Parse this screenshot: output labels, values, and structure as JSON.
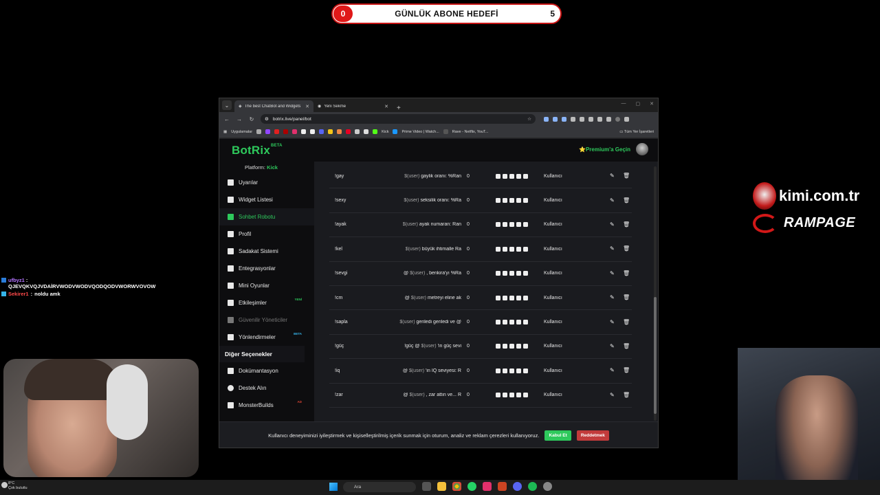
{
  "goal": {
    "current": "0",
    "title": "GÜNLÜK ABONE HEDEFİ",
    "target": "5"
  },
  "browser": {
    "tabs": [
      {
        "title": "The best ChatBot and Widgets",
        "active": true
      },
      {
        "title": "Yeni Sekme",
        "active": false
      }
    ],
    "url": "botrix.live/panel/bot",
    "bookmarks": [
      "Uygulamalar",
      "Kick",
      "Prime Video | Watch...",
      "Rave - Netflix, YouT..."
    ],
    "bookmarks_right": "Tüm Yer İşaretleri"
  },
  "botrix": {
    "logo": "BotRix",
    "beta": "BETA",
    "premium": "⭐Premium'a Geçin",
    "platform_label": "Platform:",
    "platform_value": "Kick",
    "nav": [
      {
        "label": "Uyarılar",
        "icon": "warning-icon",
        "state": "normal",
        "badge": ""
      },
      {
        "label": "Widget Listesi",
        "icon": "widgets-icon",
        "state": "normal",
        "badge": ""
      },
      {
        "label": "Sohbet Robotu",
        "icon": "robot-icon",
        "state": "active",
        "badge": ""
      },
      {
        "label": "Profil",
        "icon": "profile-icon",
        "state": "normal",
        "badge": ""
      },
      {
        "label": "Sadakat Sistemi",
        "icon": "trophy-icon",
        "state": "normal",
        "badge": ""
      },
      {
        "label": "Entegrasyonlar",
        "icon": "integrations-icon",
        "state": "normal",
        "badge": ""
      },
      {
        "label": "Mini Oyunlar",
        "icon": "gamepad-icon",
        "state": "normal",
        "badge": ""
      },
      {
        "label": "Etkileşimler",
        "icon": "music-icon",
        "state": "normal",
        "badge": "YENİ"
      },
      {
        "label": "Güvenilir Yöneticiler",
        "icon": "shield-icon",
        "state": "disabled",
        "badge": ""
      },
      {
        "label": "Yönlendirmeler",
        "icon": "users-icon",
        "state": "normal",
        "badge": "BETA"
      }
    ],
    "other_section": "Diğer Seçenekler",
    "other_nav": [
      {
        "label": "Dokümantasyon",
        "icon": "docs-icon",
        "badge": ""
      },
      {
        "label": "Destek Alın",
        "icon": "help-icon",
        "badge": ""
      },
      {
        "label": "MonsterBuilds",
        "icon": "monitor-icon",
        "badge": "AD"
      }
    ],
    "commands": [
      {
        "name": "!gay",
        "response_pre": "",
        "response_user": "$(user)",
        "response_post": " gaylik oranı: %Ran",
        "count": "0",
        "permission": "Kullanıcı"
      },
      {
        "name": "!sexy",
        "response_pre": "",
        "response_user": "$(user)",
        "response_post": " seksilik oranı: %Ra",
        "count": "0",
        "permission": "Kullanıcı"
      },
      {
        "name": "!ayak",
        "response_pre": "",
        "response_user": "$(user)",
        "response_post": " ayak numaran: Ran",
        "count": "0",
        "permission": "Kullanıcı"
      },
      {
        "name": "!kel",
        "response_pre": "",
        "response_user": "$(user)",
        "response_post": " büyük ihtimalle Ra",
        "count": "0",
        "permission": "Kullanıcı"
      },
      {
        "name": "!sevgi",
        "response_pre": "@ ",
        "response_user": "$(user)",
        "response_post": " , benkira'yı %Ra",
        "count": "0",
        "permission": "Kullanıcı"
      },
      {
        "name": "!cm",
        "response_pre": "@ ",
        "response_user": "$(user)",
        "response_post": " metreyi eline ak",
        "count": "0",
        "permission": "Kullanıcı"
      },
      {
        "name": "!sapla",
        "response_pre": "",
        "response_user": "$(user)",
        "response_post": " geriledi geriledi ve @",
        "count": "0",
        "permission": "Kullanıcı"
      },
      {
        "name": "!güç",
        "response_pre": "!güç @ ",
        "response_user": "$(user)",
        "response_post": " 'in güç sevi",
        "count": "0",
        "permission": "Kullanıcı"
      },
      {
        "name": "!iq",
        "response_pre": "@ ",
        "response_user": "$(user)",
        "response_post": " 'in IQ seviyesi: R",
        "count": "0",
        "permission": "Kullanıcı"
      },
      {
        "name": "!zar",
        "response_pre": "@ ",
        "response_user": "$(user)",
        "response_post": " , zar attın ve... R",
        "count": "0",
        "permission": "Kullanıcı"
      }
    ],
    "cookie": {
      "text": "Kullanıcı deneyiminizi iyileştirmek ve kişiselleştirilmiş içerik sunmak için oturum, analiz ve reklam çerezleri kullanıyoruz.",
      "accept": "Kabul Et",
      "reject": "Reddetmek"
    }
  },
  "chat": [
    {
      "user": "ufbyz1",
      "message": "QJEVQKVQJVDAİRVWODVWODVQODQODVWORWVOVOW",
      "color": "#b474ff"
    },
    {
      "user": "Sekirer1",
      "message": "noldu amk",
      "color": "#ff4a4a"
    }
  ],
  "branding": {
    "site": "kimi.com.tr",
    "sponsor": "RAMPAGE"
  },
  "taskbar": {
    "weather_temp": "8°C",
    "weather_desc": "Çok bulutlu",
    "search": "Ara"
  }
}
